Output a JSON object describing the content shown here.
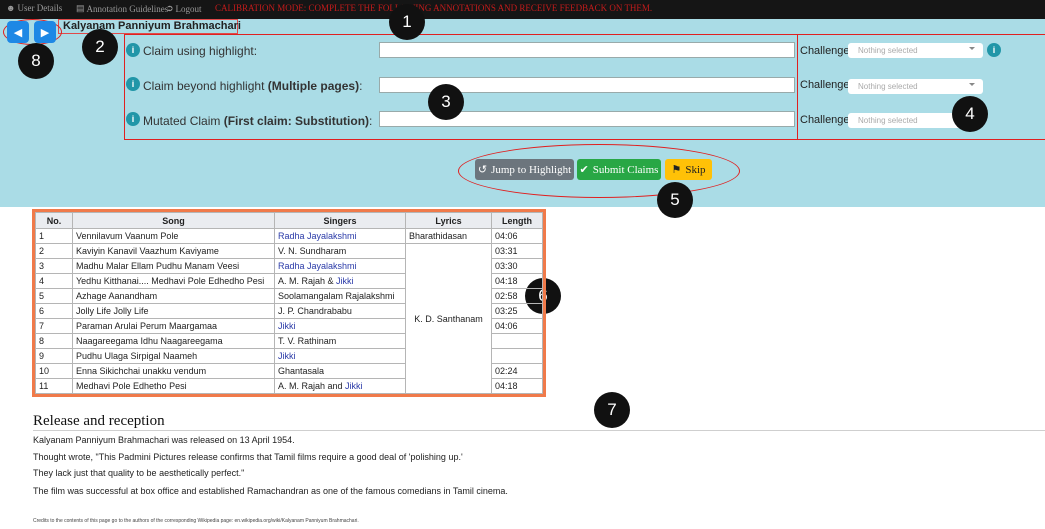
{
  "nav": {
    "user_details": "User Details",
    "annotation_guidelines": "Annotation Guidelines",
    "logout": "Logout",
    "calibration_message": "CALIBRATION MODE: COMPLETE THE FOLLOWING ANNOTATIONS AND RECEIVE FEEDBACK ON THEM."
  },
  "page_title": "Kalyanam Panniyum Brahmachari",
  "claims": [
    {
      "label": "Claim using highlight:",
      "bold": "",
      "value": "",
      "challenge_label": "Challenge:",
      "challenge_value": "Nothing selected"
    },
    {
      "label": "Claim beyond highlight ",
      "bold": "(Multiple pages)",
      "suffix": ":",
      "value": "",
      "challenge_label": "Challenge:",
      "challenge_value": "Nothing selected"
    },
    {
      "label": "Mutated Claim ",
      "bold": "(First claim: Substitution)",
      "suffix": ":",
      "value": "",
      "challenge_label": "Challenge:",
      "challenge_value": "Nothing selected"
    }
  ],
  "buttons": {
    "jump": "Jump to Highlight",
    "submit": "Submit Claims",
    "skip": "Skip"
  },
  "badges": [
    "1",
    "2",
    "3",
    "4",
    "5",
    "6",
    "7",
    "8"
  ],
  "table": {
    "headers": [
      "No.",
      "Song",
      "Singers",
      "Lyrics",
      "Length"
    ],
    "rows": [
      {
        "no": "1",
        "song": "Vennilavum Vaanum Pole",
        "singers": "Radha Jayalakshmi",
        "link": true,
        "length": "04:06"
      },
      {
        "no": "2",
        "song": "Kaviyin Kanavil Vaazhum Kaviyame",
        "singers": "V. N. Sundharam",
        "link": false,
        "length": "03:31"
      },
      {
        "no": "3",
        "song": "Madhu Malar Ellam Pudhu Manam Veesi",
        "singers": "Radha Jayalakshmi",
        "link": true,
        "length": "03:30"
      },
      {
        "no": "4",
        "song": "Yedhu Kitthanai.... Medhavi Pole Edhedho Pesi",
        "singers_plain": "A. M. Rajah & ",
        "singers_link": "Jikki",
        "length": "04:18"
      },
      {
        "no": "5",
        "song": "Azhage Aanandham",
        "singers": "Soolamangalam Rajalakshmi",
        "link": false,
        "length": "02:58"
      },
      {
        "no": "6",
        "song": "Jolly Life Jolly Life",
        "singers": "J. P. Chandrababu",
        "link": false,
        "length": "03:25"
      },
      {
        "no": "7",
        "song": "Paraman Arulai Perum Maargamaa",
        "singers": "Jikki",
        "link": true,
        "length": "04:06"
      },
      {
        "no": "8",
        "song": "Naagareegama Idhu Naagareegama",
        "singers": "T. V. Rathinam",
        "link": false,
        "length": ""
      },
      {
        "no": "9",
        "song": "Pudhu Ulaga Sirpigal Naameh",
        "singers": "Jikki",
        "link": true,
        "length": ""
      },
      {
        "no": "10",
        "song": "Enna Sikichchai unakku vendum",
        "singers": "Ghantasala",
        "link": false,
        "length": "02:24"
      },
      {
        "no": "11",
        "song": "Medhavi Pole Edhetho Pesi",
        "singers_plain": "A. M. Rajah and ",
        "singers_link": "Jikki",
        "length": "04:18"
      }
    ],
    "lyrics_first": "Bharathidasan",
    "lyrics_merged": "K. D. Santhanam"
  },
  "release": {
    "heading": "Release and reception",
    "paragraphs": [
      "Kalyanam Panniyum Brahmachari was released on 13 April 1954.",
      "Thought wrote, \"This Padmini Pictures release confirms that Tamil films require a good deal of 'polishing up.'",
      "They lack just that quality to be aesthetically perfect.\"",
      "The film was successful at box office and established Ramachandran as one of the famous comedians in Tamil cinema."
    ]
  },
  "credits": "Credits to the contents of this page go to the authors of the corresponding Wikipedia page: en.wikipedia.org/wiki/Kalyanam Panniyum Brahmachari.",
  "colors": {
    "panel": "#aadce6",
    "nav_btn": "#1e88e5",
    "submit": "#28a745",
    "skip": "#ffc107",
    "jump": "#6c757d",
    "annotation_red": "#e02020"
  }
}
